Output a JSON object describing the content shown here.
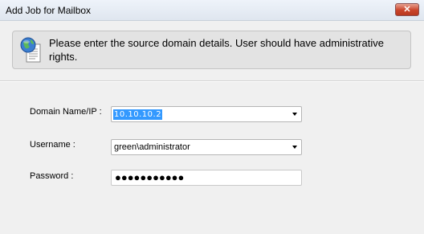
{
  "window": {
    "title": "Add Job for Mailbox",
    "close_glyph": "✕"
  },
  "info": {
    "icon": "globe-document-icon",
    "message": "Please enter the source domain details. User should have administrative rights."
  },
  "form": {
    "domain": {
      "label": "Domain Name/IP :",
      "value": "10.10.10.2"
    },
    "username": {
      "label": "Username :",
      "value": "green\\administrator"
    },
    "password": {
      "label": "Password :",
      "value_masked": "●●●●●●●●●●●"
    }
  },
  "colors": {
    "selection": "#3399ff",
    "close_button": "#c9442a",
    "panel_bg": "#e3e3e3",
    "window_bg": "#f0f0f0"
  }
}
